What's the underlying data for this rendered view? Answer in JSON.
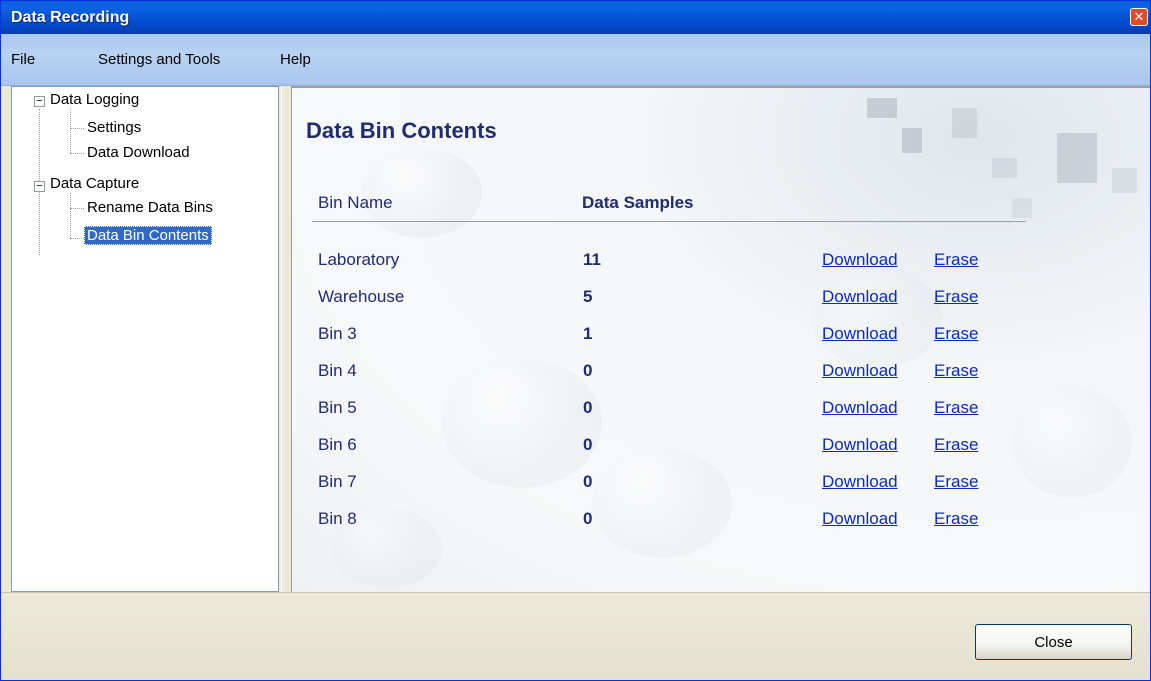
{
  "window": {
    "title": "Data Recording"
  },
  "menu": [
    "File",
    "Settings and Tools",
    "Help"
  ],
  "tree": {
    "groups": [
      {
        "label": "Data Logging",
        "toggle": "−",
        "children": [
          "Settings",
          "Data Download"
        ]
      },
      {
        "label": "Data Capture",
        "toggle": "−",
        "children": [
          "Rename Data Bins",
          "Data Bin Contents"
        ]
      }
    ],
    "selected": "Data Bin Contents"
  },
  "content": {
    "heading": "Data Bin Contents",
    "columns": {
      "name": "Bin Name",
      "samples": "Data Samples"
    },
    "rows": [
      {
        "name": "Laboratory",
        "samples": "11",
        "download": "Download",
        "erase": "Erase"
      },
      {
        "name": "Warehouse",
        "samples": "5",
        "download": "Download",
        "erase": "Erase"
      },
      {
        "name": "Bin 3",
        "samples": "1",
        "download": "Download",
        "erase": "Erase"
      },
      {
        "name": "Bin 4",
        "samples": "0",
        "download": "Download",
        "erase": "Erase"
      },
      {
        "name": "Bin 5",
        "samples": "0",
        "download": "Download",
        "erase": "Erase"
      },
      {
        "name": "Bin 6",
        "samples": "0",
        "download": "Download",
        "erase": "Erase"
      },
      {
        "name": "Bin 7",
        "samples": "0",
        "download": "Download",
        "erase": "Erase"
      },
      {
        "name": "Bin 8",
        "samples": "0",
        "download": "Download",
        "erase": "Erase"
      }
    ]
  },
  "footer": {
    "close_label": "Close"
  },
  "icons": {
    "close": "close-icon",
    "tree_toggle": "collapse-toggle-icon"
  },
  "colors": {
    "titlebar": "#0553d4",
    "heading": "#1f2c6e",
    "link": "#0a2bbd",
    "selection": "#316ac5"
  }
}
